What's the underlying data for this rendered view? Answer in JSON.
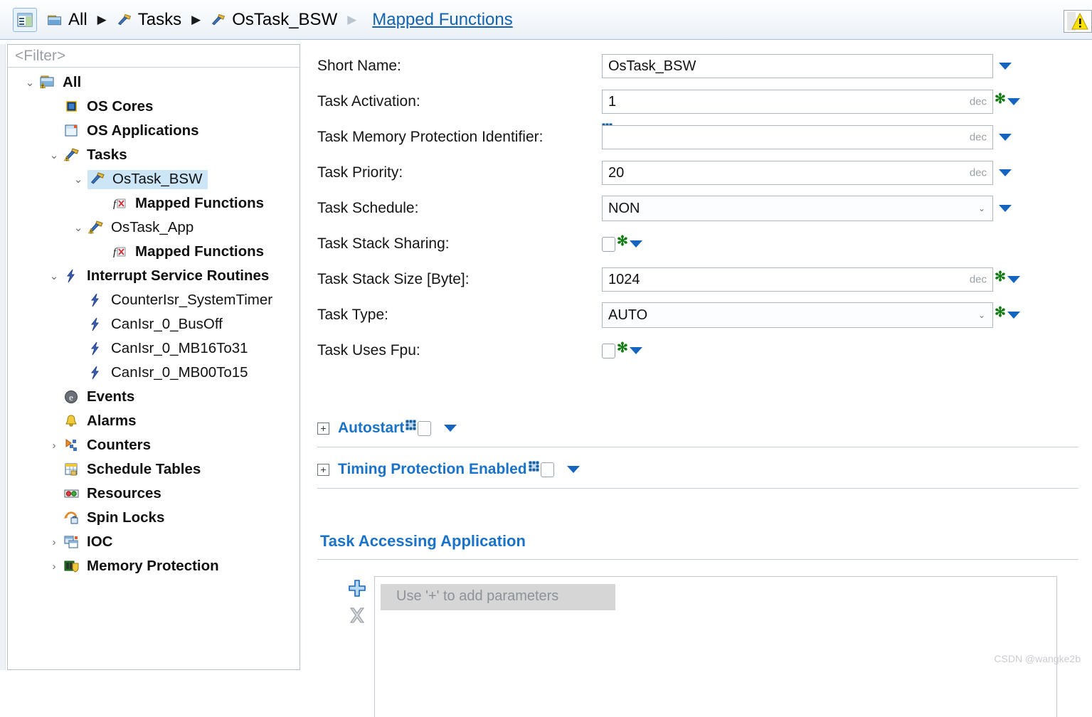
{
  "breadcrumb": {
    "home_icon": "tree-view-icon",
    "items": [
      {
        "icon": "folder-icon",
        "label": "All",
        "link": false,
        "sep": "arrow-right"
      },
      {
        "icon": "hammer-icon",
        "label": "Tasks",
        "link": false,
        "sep": "arrow-right"
      },
      {
        "icon": "hammer-icon",
        "label": "OsTask_BSW",
        "link": false,
        "sep": "arrow-right-light"
      },
      {
        "icon": "none",
        "label": "Mapped Functions",
        "link": true,
        "sep": "none"
      }
    ],
    "corner_icon": "warning-triangle-icon"
  },
  "tree": {
    "filter_placeholder": "<Filter>",
    "items": [
      {
        "label": "All",
        "level": 0,
        "twisty": "expanded",
        "icon": "folder-warning-icon",
        "bold": true,
        "selected": false
      },
      {
        "label": "OS Cores",
        "level": 1,
        "twisty": "none",
        "icon": "chip-icon",
        "bold": true,
        "selected": false
      },
      {
        "label": "OS Applications",
        "level": 1,
        "twisty": "none",
        "icon": "window-icon",
        "bold": true,
        "selected": false
      },
      {
        "label": "Tasks",
        "level": 1,
        "twisty": "expanded",
        "icon": "hammer-warning-icon",
        "bold": true,
        "selected": false
      },
      {
        "label": "OsTask_BSW",
        "level": 2,
        "twisty": "expanded",
        "icon": "hammer-icon",
        "bold": false,
        "selected": true
      },
      {
        "label": "Mapped Functions",
        "level": 3,
        "twisty": "none",
        "icon": "function-error-icon",
        "bold": true,
        "selected": false
      },
      {
        "label": "OsTask_App",
        "level": 2,
        "twisty": "expanded",
        "icon": "hammer-warning-icon",
        "bold": false,
        "selected": false
      },
      {
        "label": "Mapped Functions",
        "level": 3,
        "twisty": "none",
        "icon": "function-error-icon",
        "bold": true,
        "selected": false
      },
      {
        "label": "Interrupt Service Routines",
        "level": 1,
        "twisty": "expanded",
        "icon": "bolt-icon",
        "bold": true,
        "selected": false
      },
      {
        "label": "CounterIsr_SystemTimer",
        "level": 2,
        "twisty": "none",
        "icon": "bolt-icon",
        "bold": false,
        "selected": false
      },
      {
        "label": "CanIsr_0_BusOff",
        "level": 2,
        "twisty": "none",
        "icon": "bolt-icon",
        "bold": false,
        "selected": false
      },
      {
        "label": "CanIsr_0_MB16To31",
        "level": 2,
        "twisty": "none",
        "icon": "bolt-icon",
        "bold": false,
        "selected": false
      },
      {
        "label": "CanIsr_0_MB00To15",
        "level": 2,
        "twisty": "none",
        "icon": "bolt-icon",
        "bold": false,
        "selected": false
      },
      {
        "label": "Events",
        "level": 1,
        "twisty": "none",
        "icon": "event-circle-icon",
        "bold": true,
        "selected": false
      },
      {
        "label": "Alarms",
        "level": 1,
        "twisty": "none",
        "icon": "bell-icon",
        "bold": true,
        "selected": false
      },
      {
        "label": "Counters",
        "level": 1,
        "twisty": "collapsed",
        "icon": "counter-icon",
        "bold": true,
        "selected": false
      },
      {
        "label": "Schedule Tables",
        "level": 1,
        "twisty": "none",
        "icon": "schedule-table-icon",
        "bold": true,
        "selected": false
      },
      {
        "label": "Resources",
        "level": 1,
        "twisty": "none",
        "icon": "resources-icon",
        "bold": true,
        "selected": false
      },
      {
        "label": "Spin Locks",
        "level": 1,
        "twisty": "none",
        "icon": "spin-lock-icon",
        "bold": true,
        "selected": false
      },
      {
        "label": "IOC",
        "level": 1,
        "twisty": "collapsed",
        "icon": "ioc-icon",
        "bold": true,
        "selected": false
      },
      {
        "label": "Memory Protection",
        "level": 1,
        "twisty": "collapsed",
        "icon": "memory-shield-icon",
        "bold": true,
        "selected": false
      }
    ]
  },
  "form": {
    "rows": [
      {
        "label": "Short Name:",
        "kind": "text",
        "value": "OsTask_BSW",
        "unit": "",
        "star": false,
        "dotmark": false
      },
      {
        "label": "Task Activation:",
        "kind": "text",
        "value": "1",
        "unit": "dec",
        "star": true,
        "dotmark": false
      },
      {
        "label": "Task Memory Protection Identifier:",
        "kind": "text",
        "value": "",
        "unit": "dec",
        "star": false,
        "dotmark": true
      },
      {
        "label": "Task Priority:",
        "kind": "text",
        "value": "20",
        "unit": "dec",
        "star": false,
        "dotmark": false
      },
      {
        "label": "Task Schedule:",
        "kind": "select",
        "value": "NON",
        "unit": "",
        "star": false,
        "dotmark": false
      },
      {
        "label": "Task Stack Sharing:",
        "kind": "checkbox",
        "value": "",
        "unit": "",
        "star": true,
        "dotmark": false
      },
      {
        "label": "Task Stack Size [Byte]:",
        "kind": "text",
        "value": "1024",
        "unit": "dec",
        "star": true,
        "dotmark": false
      },
      {
        "label": "Task Type:",
        "kind": "select",
        "value": "AUTO",
        "unit": "",
        "star": true,
        "dotmark": false
      },
      {
        "label": "Task Uses Fpu:",
        "kind": "checkbox",
        "value": "",
        "unit": "",
        "star": true,
        "dotmark": false
      }
    ],
    "sections": [
      {
        "expander": "+",
        "title": "Autostart"
      },
      {
        "expander": "+",
        "title": "Timing Protection Enabled"
      }
    ],
    "task_accessing": {
      "title": "Task Accessing Application",
      "add_icon": "plus-icon",
      "delete_icon": "x-delete-icon",
      "placeholder": "Use '+' to add parameters"
    }
  },
  "watermark": "CSDN @wangke2b",
  "colors": {
    "link": "#1363b0",
    "section_title": "#1a73c8",
    "selection": "#cde6f7",
    "star_green": "#127c12",
    "blue_triangle": "#1565c0"
  }
}
